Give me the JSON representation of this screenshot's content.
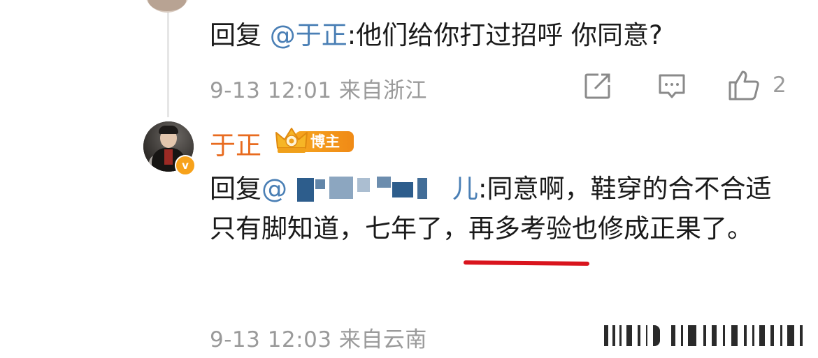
{
  "reply_top": {
    "prefix": "回复",
    "mention": "@于正",
    "text": ":他们给你打过招呼 你同意?",
    "meta": "9-13 12:01 来自浙江",
    "like_count": "2"
  },
  "comment": {
    "username": "于正",
    "badge": "博主",
    "verified_mark": "v",
    "reply_prefix": "回复",
    "mention_at": "@",
    "mention_tail": "儿",
    "body_line1": ":同意啊，鞋穿的合不",
    "body_rest": "合适只有脚知道，七年了，再多考验也修成正果了。",
    "meta": "9-13 12:03 来自云南"
  },
  "icons": {
    "share": "share-icon",
    "comment": "comment-icon",
    "like": "like-icon",
    "crown": "crown-icon"
  },
  "colors": {
    "username": "#e86b1f",
    "mention": "#4a7fb5",
    "meta": "#9a9a9a",
    "highlight_underline": "#d9141d",
    "badge": "#f6a51f"
  }
}
